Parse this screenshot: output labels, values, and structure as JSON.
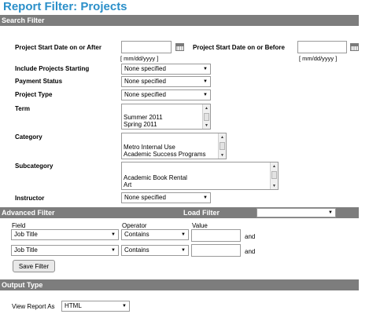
{
  "page_title": "Report Filter: Projects",
  "search_filter": {
    "header": "Search Filter",
    "start_after_label": "Project Start Date  on or After",
    "start_before_label": "Project Start Date  on or Before",
    "date_hint": "[ mm/dd/yyyy ]",
    "include_projects_label": "Include Projects Starting",
    "include_projects_value": "None specified",
    "payment_status_label": "Payment Status",
    "payment_status_value": "None specified",
    "project_type_label": "Project Type",
    "project_type_value": "None specified",
    "term_label": "Term",
    "term_items": [
      "Summer 2011",
      "Spring 2011"
    ],
    "category_label": "Category",
    "category_items": [
      "Metro Internal Use",
      "Academic Success Programs"
    ],
    "subcategory_label": "Subcategory",
    "subcategory_items": [
      "Academic Book Rental",
      "Art"
    ],
    "instructor_label": "Instructor",
    "instructor_value": "None specified"
  },
  "advanced_filter": {
    "header": "Advanced Filter",
    "load_filter_label": "Load Filter",
    "load_filter_value": "",
    "col_field": "Field",
    "col_operator": "Operator",
    "col_value": "Value",
    "rows": [
      {
        "field": "Job Title",
        "operator": "Contains",
        "value": "",
        "conjunction": "and"
      },
      {
        "field": "Job Title",
        "operator": "Contains",
        "value": "",
        "conjunction": "and"
      }
    ],
    "save_button": "Save Filter"
  },
  "output_type": {
    "header": "Output Type",
    "view_as_label": "View Report As",
    "view_as_value": "HTML"
  }
}
